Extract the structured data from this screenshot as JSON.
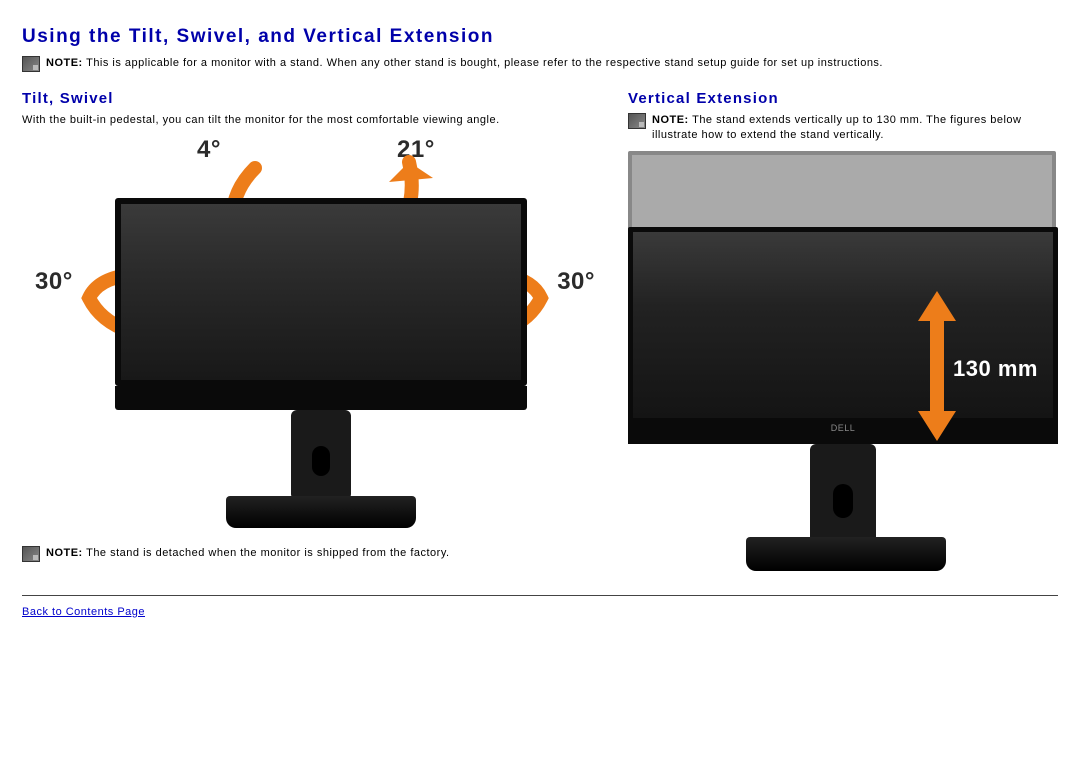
{
  "main_title": "Using the Tilt, Swivel, and Vertical Extension",
  "note1": {
    "label": "NOTE:",
    "text": "This is applicable for a monitor with a stand. When any other stand is bought, please refer to the respective stand setup guide for set up instructions."
  },
  "left": {
    "heading": "Tilt, Swivel",
    "desc": "With the built-in pedestal, you can tilt the monitor for the most comfortable viewing angle.",
    "labels": {
      "tilt_back": "4°",
      "tilt_forward": "21°",
      "swivel_left": "30°",
      "swivel_right": "30°"
    }
  },
  "right": {
    "heading": "Vertical Extension",
    "note": {
      "label": "NOTE:",
      "text": "The stand extends vertically up to 130 mm. The figures below illustrate how to extend the stand vertically."
    },
    "mm_label": "130 mm"
  },
  "note2": {
    "label": "NOTE:",
    "text": "The stand is detached when the monitor is shipped from the factory."
  },
  "back_link": "Back to Contents Page"
}
